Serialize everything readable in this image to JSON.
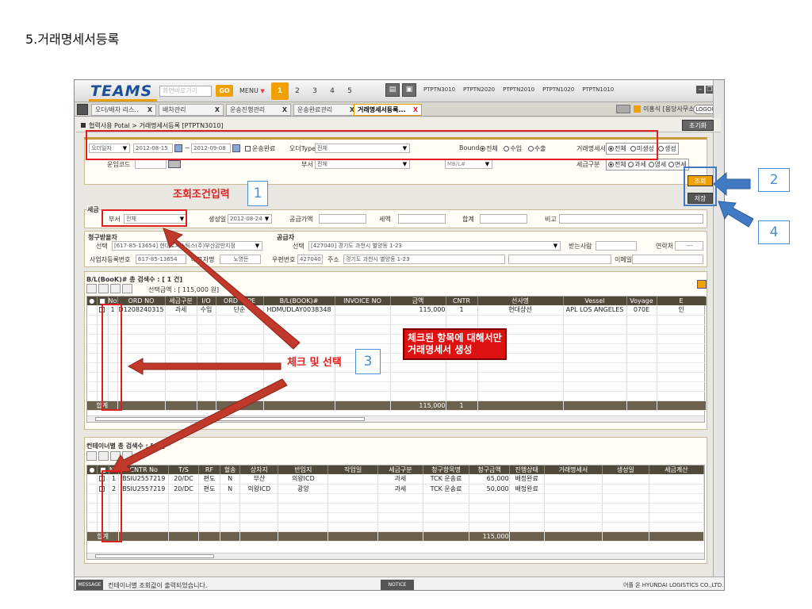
{
  "heading": "5.거래명세서등록",
  "app": {
    "logo": "TEAMS",
    "quick_placeholder": "화면바로가기",
    "go_label": "GO",
    "menu_label": "MENU",
    "pages": [
      "1",
      "2",
      "3",
      "4",
      "5"
    ],
    "program_links": [
      "PTPTN3010",
      "PTPTN2020",
      "PTPTN2010",
      "PTPTN1020",
      "PTPTN1010"
    ]
  },
  "tabs": [
    {
      "label": "오더/배차 리스..",
      "close": "X"
    },
    {
      "label": "배차관리",
      "close": "X"
    },
    {
      "label": "운송진행관리",
      "close": "X"
    },
    {
      "label": "운송완료관리",
      "close": "X"
    },
    {
      "label": "거래명세서등록...",
      "close": "X"
    }
  ],
  "user": {
    "name": "이홍식 [용당사무소]",
    "logout": "LOGOUT"
  },
  "breadcrumb": "협력사용 Potal > 거래명세서등록 [PTPTN3010]",
  "init_button": "초기화",
  "search": {
    "date_type": "오더일자",
    "date_from": "2012-08-15",
    "date_sep": "~",
    "date_to": "2012-09-08",
    "transport_done": "운송완료",
    "order_type_label": "오더Type",
    "order_type_value": "전체",
    "bound_label": "Bound",
    "bound_options": [
      "전체",
      "수입",
      "수출"
    ],
    "invoice_label": "거래명세서",
    "invoice_options": [
      "전체",
      "미생성",
      "생성"
    ],
    "work_code_label": "운임코드",
    "dept_label": "부서",
    "dept_value": "전체",
    "mbl_label": "MB/L#",
    "tax_label": "세금구분",
    "tax_options": [
      "전체",
      "과세",
      "영세",
      "면세"
    ],
    "query_button": "조회",
    "save_button": "저장"
  },
  "tax_section": {
    "title": "세금",
    "dept_label": "부서",
    "dept_value": "전체",
    "created_label": "생성일",
    "created_value": "2012-08-24",
    "supply_label": "공급가액",
    "tax_label": "세액",
    "total_label": "합계",
    "note_label": "비고"
  },
  "party": {
    "buyer_title": "청구받을자",
    "buyer_select_label": "선택",
    "buyer_value": "[617-85-13654] 현대로지스틱스(주)부산감만지점",
    "buyer_reg_label": "사업자등록번호",
    "buyer_reg_value": "617-85-13654",
    "ceo_label": "대표자명",
    "ceo_value": "노영돈",
    "supplier_title": "공급자",
    "supplier_select_label": "선택",
    "supplier_value": "[427040] 경기도 과천시 별양동 1-23",
    "zip_label": "우편번호",
    "zip_value": "427040",
    "addr_label": "주소",
    "addr_value": "경기도 과천시 별양동 1-23",
    "receiver_label": "받는사람",
    "contact_label": "연락처",
    "contact_value": "---",
    "email_label": "이메일"
  },
  "bl_grid": {
    "title": "B/L(BooK)# 총 검색수 : [ 1 건]",
    "selected_amount": "선택금액 : [ 115,000 원]",
    "columns": [
      "No",
      "ORD NO",
      "세금구분",
      "I/O",
      "ORD TYPE",
      "B/L(BOOK)#",
      "INVOICE NO",
      "금액",
      "CNTR",
      "선사명",
      "Vessel",
      "Voyage",
      "E"
    ],
    "rows": [
      [
        "1",
        "D1208240315",
        "과세",
        "수입",
        "단순",
        "HDMUDLAY0038348",
        "",
        "115,000",
        "1",
        "현대상선",
        "APL LOS ANGELES",
        "070E",
        "인"
      ]
    ],
    "sum_label": "합계",
    "sum_amount": "115,000",
    "sum_cntr": "1"
  },
  "cntr_grid": {
    "title": "컨테이너별 총 검색수 : [ 2 ]",
    "columns": [
      "No",
      "CNTR No",
      "T/S",
      "RF",
      "혈송",
      "상차지",
      "반입지",
      "작업일",
      "세금구분",
      "청구항목명",
      "청구금액",
      "진행상태",
      "거래명세서",
      "생성일",
      "세금계산"
    ],
    "rows": [
      [
        "1",
        "BSIU2557219",
        "20/DC",
        "편도",
        "N",
        "부산",
        "의왕ICD",
        "",
        "과세",
        "TCK 운송료",
        "65,000",
        "배정완료",
        "",
        "",
        ""
      ],
      [
        "2",
        "BSIU2557219",
        "20/DC",
        "편도",
        "N",
        "의왕ICD",
        "광양",
        "",
        "과세",
        "TCK 운송료",
        "50,000",
        "배정완료",
        "",
        "",
        ""
      ]
    ],
    "sum_label": "합계",
    "sum_amount": "115,000"
  },
  "status": {
    "message_tag": "MESSAGE",
    "message": "컨테이너별 조회값이 출력되었습니다.",
    "notice_tag": "NOTICE",
    "footer": "어플 온 HYUNDAI LOGISTICS CO.,LTD."
  },
  "annotations": {
    "search_caption": "조회조건입력",
    "check_caption": "체크 및 선택",
    "callout": [
      "체크된 항목에 대해서만",
      "거래명세서 생성"
    ],
    "n1": "1",
    "n2": "2",
    "n3": "3",
    "n4": "4"
  },
  "colors": {
    "accent": "#f0a000",
    "annotation": "#e02020",
    "header": "#51493a",
    "logo": "#1c4f96"
  }
}
